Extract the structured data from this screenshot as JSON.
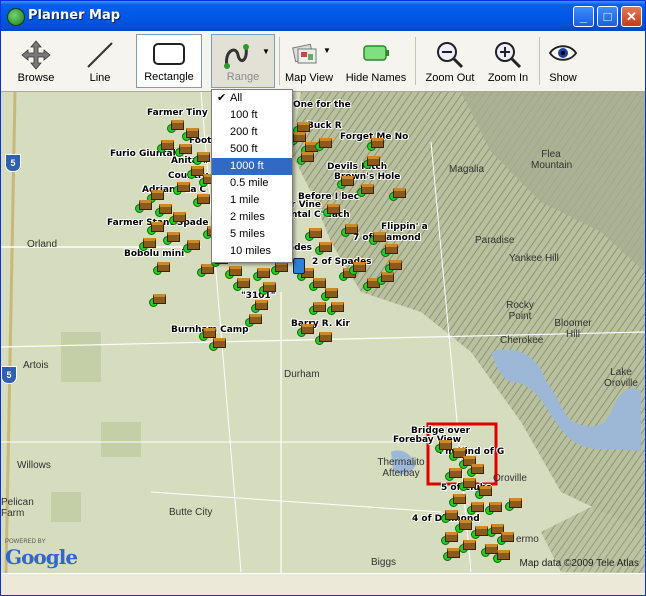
{
  "window": {
    "title": "Planner Map"
  },
  "toolbar": {
    "browse": "Browse",
    "line": "Line",
    "rectangle": "Rectangle",
    "range": "Range",
    "map_view": "Map View",
    "hide_names": "Hide Names",
    "zoom_out": "Zoom Out",
    "zoom_in": "Zoom In",
    "show": "Show"
  },
  "range_menu": {
    "items": [
      "All",
      "100 ft",
      "200 ft",
      "500 ft",
      "1000 ft",
      "0.5 mile",
      "1 mile",
      "2 miles",
      "5 miles",
      "10 miles"
    ],
    "checked": "All",
    "highlighted": "1000 ft"
  },
  "map": {
    "cities": [
      "Orland",
      "Magalia",
      "Paradise",
      "Flea Mountain",
      "Yankee Hill",
      "Rocky Point",
      "Cherokee",
      "Bloomer Hill",
      "Lake Oroville",
      "Artois",
      "Durham",
      "Willows",
      "Butte City",
      "Pelican Farm",
      "Thermalito Afterbay",
      "Oroville",
      "Biggs",
      "ermo"
    ],
    "caches": [
      "Farmer Tiny",
      "One for the",
      "Buck R",
      "Foot",
      "Forget Me No",
      "Furio Giuntala",
      "Anitar#",
      "Devils Kitch",
      "Country",
      "Brown's Hole",
      "Adriana La C",
      "Before I bec",
      "Farmer Stant Spade",
      "r Vine",
      "ntal C' cach",
      "Flippin' a",
      "7 of Diamond",
      "Bobolu mini",
      "ades",
      "2 of Spades",
      "\"3101\"",
      "Burnham Camp",
      "Barry R. Kir",
      "Bridge over",
      "Forebay View",
      "I'm Kind of G",
      "5 of Clubs",
      "4 of Diamond"
    ],
    "highways": [
      "5",
      "5"
    ],
    "credit": "Map data ©2009 Tele Atlas",
    "google_powered": "POWERED BY",
    "google_logo": "Google"
  }
}
